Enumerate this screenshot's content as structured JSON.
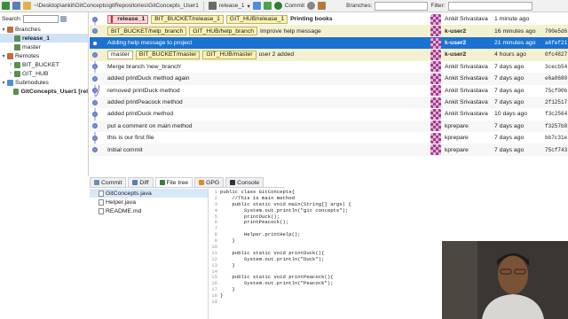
{
  "toolbar": {
    "path": "~\\Desktop\\ankit\\GitConcepts\\gitRepositories\\GitConcepts_User1",
    "branch": "release_1",
    "commit_label": "Commit",
    "branches_label": "Branches:",
    "filter_label": "Filter:"
  },
  "left_panel": {
    "search_label": "Search:",
    "items": [
      {
        "label": "Branches",
        "level": 0,
        "arrow": "▾"
      },
      {
        "label": "release_1",
        "level": 1,
        "arrow": "",
        "selected": true,
        "bold": true
      },
      {
        "label": "master",
        "level": 1,
        "arrow": ""
      },
      {
        "label": "Remotes",
        "level": 0,
        "arrow": "▾"
      },
      {
        "label": "BIT_BUCKET",
        "level": 1,
        "arrow": "›"
      },
      {
        "label": "GIT_HUB",
        "level": 1,
        "arrow": "›"
      },
      {
        "label": "Submodules",
        "level": 0,
        "arrow": "▾"
      },
      {
        "label": "GitConcepts_User1 [rel",
        "level": 1,
        "arrow": "",
        "bold": true
      }
    ]
  },
  "commits": [
    {
      "refs": [
        {
          "t": "release_1",
          "k": "head"
        },
        {
          "t": "BIT_BUCKET/release_1",
          "k": "remote"
        },
        {
          "t": "GIT_HUB/release_1",
          "k": "remote"
        }
      ],
      "message": "Printing books",
      "bold": true,
      "author": "Ankit Srivastava",
      "date": "1 minute ago",
      "sha": "",
      "style": "normal"
    },
    {
      "refs": [
        {
          "t": "BIT_BUCKET/help_branch",
          "k": "remote"
        },
        {
          "t": "GIT_HUB/help_branch",
          "k": "remote"
        }
      ],
      "message": "Improve help message",
      "author": "k-user2",
      "date": "16 minutes ago",
      "sha": "700e5d6",
      "style": "soft",
      "author_bold": true
    },
    {
      "refs": [],
      "message": "Adding help message to project",
      "author": "k-user2",
      "date": "21 minutes ago",
      "sha": "a6fef21",
      "style": "sel",
      "author_bold": true
    },
    {
      "refs": [
        {
          "t": "master",
          "k": "plain"
        },
        {
          "t": "BIT_BUCKET/master",
          "k": "remote"
        },
        {
          "t": "GIT_HUB/master",
          "k": "remote"
        }
      ],
      "message": "user 2 added",
      "author": "k-user2",
      "date": "4 hours ago",
      "sha": "0fc4827",
      "style": "soft",
      "author_bold": true
    },
    {
      "refs": [],
      "message": "Merge branch 'new_branch'",
      "author": "Ankit Srivastava",
      "date": "7 days ago",
      "sha": "3cecb54",
      "style": "normal"
    },
    {
      "refs": [],
      "message": "added printDuck method again",
      "author": "Ankit Srivastava",
      "date": "7 days ago",
      "sha": "e6a0680",
      "style": "alt"
    },
    {
      "refs": [],
      "message": "removed printDuck method",
      "author": "Ankit Srivastava",
      "date": "7 days ago",
      "sha": "75cf00b",
      "style": "normal"
    },
    {
      "refs": [],
      "message": "added printPeacock method",
      "author": "Ankit Srivastava",
      "date": "7 days ago",
      "sha": "2f12517",
      "style": "alt"
    },
    {
      "refs": [],
      "message": "added printDuck method",
      "author": "Ankit Srivastava",
      "date": "10 days ago",
      "sha": "f3c2564",
      "style": "normal"
    },
    {
      "refs": [],
      "message": "put a comment on main method",
      "author": "kprepare",
      "date": "7 days ago",
      "sha": "f3257b8",
      "style": "alt"
    },
    {
      "refs": [],
      "message": "this is our first file",
      "author": "kprepare",
      "date": "7 days ago",
      "sha": "bb7c31e",
      "style": "normal"
    },
    {
      "refs": [],
      "message": "Initial commit",
      "author": "kprepare",
      "date": "7 days ago",
      "sha": "75cf743",
      "style": "alt"
    }
  ],
  "tabs": [
    {
      "label": "Commit",
      "color": "#6b8fb3"
    },
    {
      "label": "Diff",
      "color": "#5b7fa8"
    },
    {
      "label": "File tree",
      "color": "#3c7a3c",
      "active": true
    },
    {
      "label": "GPG",
      "color": "#d98a2b"
    },
    {
      "label": "Console",
      "color": "#333333"
    }
  ],
  "files": [
    {
      "name": "GitConcepts.java",
      "selected": true
    },
    {
      "name": "Helper.java"
    },
    {
      "name": "README.md"
    }
  ],
  "code_lines": [
    "public class GitConcepts{",
    "    //This is main method",
    "    public static void main(String[] args) {",
    "        System.out.println(\"git concepts\");",
    "        printDuck();",
    "        printPeacock();",
    "",
    "        Helper.printHelp();",
    "    }",
    "",
    "    public static void printDuck(){",
    "        System.out.println(\"Duck\");",
    "    }",
    "",
    "    public static void printPeacock(){",
    "        System.out.println(\"Peacock\");",
    "    }",
    "}",
    ""
  ],
  "colors": {
    "selection": "#1a73d1",
    "graph_line": "#7a8fd6"
  }
}
